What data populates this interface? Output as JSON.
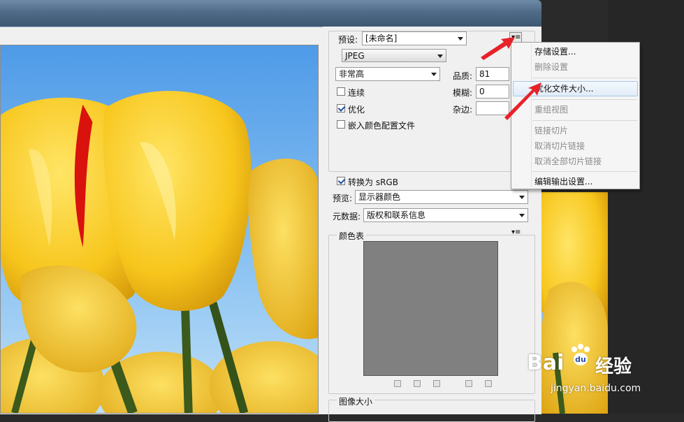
{
  "panel": {
    "preset_label": "预设:",
    "preset_value": "[未命名]",
    "format_value": "JPEG",
    "quality_level": "非常高",
    "quality_label": "品质:",
    "quality_value": "81",
    "progressive_label": "连续",
    "progressive_checked": false,
    "blur_label": "模糊:",
    "blur_value": "0",
    "optimized_label": "优化",
    "optimized_checked": true,
    "matte_label": "杂边:",
    "embed_profile_label": "嵌入颜色配置文件",
    "embed_profile_checked": false,
    "convert_srgb_label": "转换为 sRGB",
    "convert_srgb_checked": true,
    "preview_label": "预览:",
    "preview_value": "显示器颜色",
    "metadata_label": "元数据:",
    "metadata_value": "版权和联系信息",
    "color_table_label": "颜色表",
    "image_size_label": "图像大小"
  },
  "menu": {
    "items": [
      {
        "label": "存储设置...",
        "enabled": true
      },
      {
        "label": "删除设置",
        "enabled": false
      },
      {
        "label": "优化文件大小...",
        "enabled": true,
        "highlighted": true
      },
      {
        "label": "重组视图",
        "enabled": false
      },
      {
        "label": "链接切片",
        "enabled": false
      },
      {
        "label": "取消切片链接",
        "enabled": false
      },
      {
        "label": "取消全部切片链接",
        "enabled": false
      },
      {
        "label": "编辑输出设置...",
        "enabled": true
      }
    ]
  },
  "watermark": {
    "brand": "Bai",
    "brand_suffix": "经验",
    "url": "jingyan.baidu.com"
  },
  "colors": {
    "annotation_arrow": "#e8222a",
    "menu_highlight": "#e1ecf8",
    "color_table_fill": "#808080"
  }
}
